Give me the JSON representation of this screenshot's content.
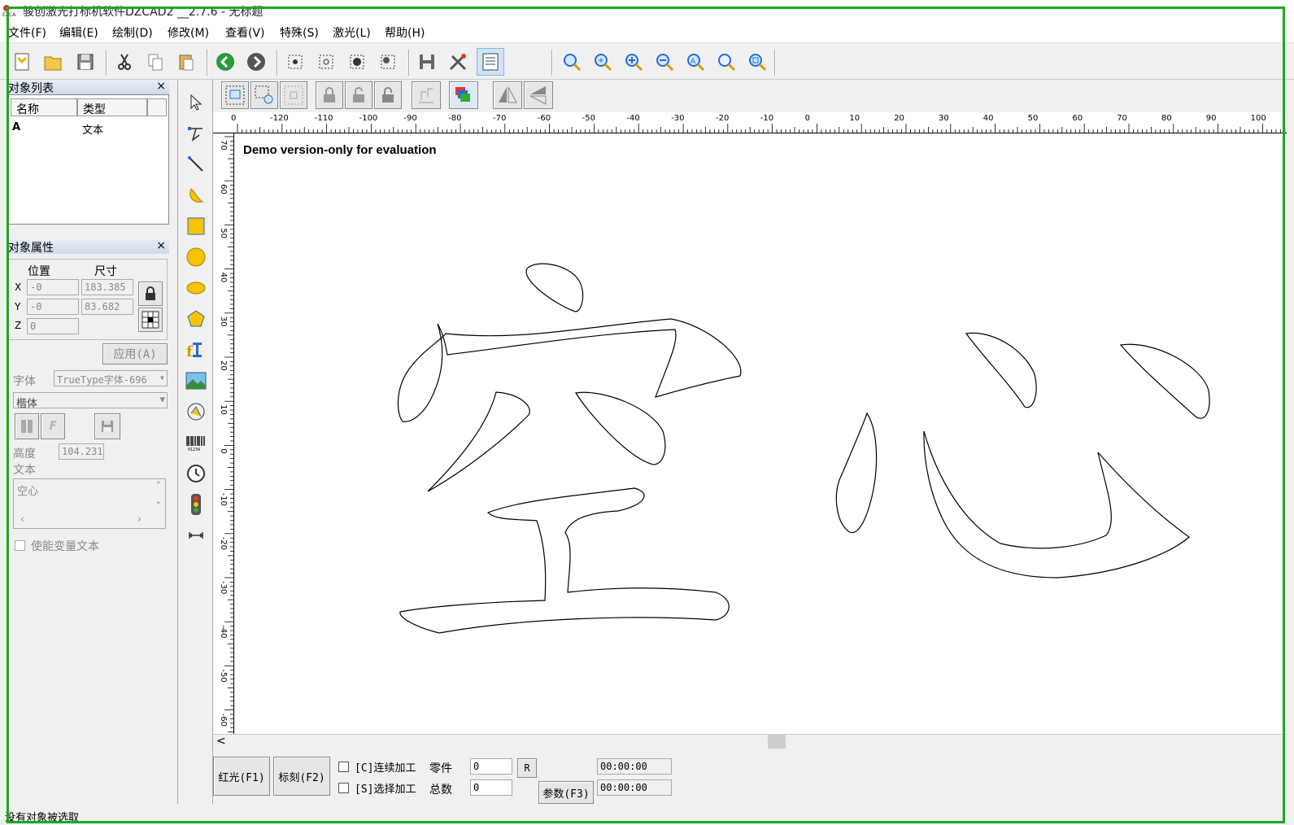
{
  "window": {
    "title": "骏创激光打标机软件DZCAD2 __2.7.6 - 无标题"
  },
  "menu": [
    {
      "label": "文件(F)"
    },
    {
      "label": "编辑(E)"
    },
    {
      "label": "绘制(D)"
    },
    {
      "label": "修改(M)"
    },
    {
      "label": "查看(V)"
    },
    {
      "label": "特殊(S)"
    },
    {
      "label": "激光(L)"
    },
    {
      "label": "帮助(H)"
    }
  ],
  "object_list": {
    "title": "对象列表",
    "close": "×",
    "col_name": "名称",
    "col_type": "类型",
    "rows": [
      {
        "name": "A",
        "type": "文本"
      }
    ]
  },
  "object_props": {
    "title": "对象属性",
    "close": "×",
    "position_label": "位置",
    "size_label": "尺寸",
    "x_label": "X",
    "y_label": "Y",
    "z_label": "Z",
    "x_pos": "-0",
    "y_pos": "-0",
    "z_pos": "0",
    "x_size": "183.385",
    "y_size": "83.682",
    "apply_label": "应用(A)",
    "font_label": "字体",
    "font_type": "TrueType字体-696",
    "font_name": "楷体",
    "height_label": "高度",
    "height_value": "104.231",
    "text_label": "文本",
    "text_value": "空心",
    "variable_text_label": "使能变量文本"
  },
  "canvas": {
    "watermark": "Demo version-only for evaluation",
    "ruler_top_labels": [
      "0",
      "-120",
      "-110",
      "-100",
      "-90",
      "-80",
      "-70",
      "-60",
      "-50",
      "-40",
      "-30",
      "-20",
      "-10",
      "0",
      "10",
      "20",
      "30",
      "40",
      "50",
      "60",
      "70",
      "80",
      "90",
      "100"
    ],
    "ruler_left_labels": [
      "70",
      "60",
      "50",
      "40",
      "30",
      "20",
      "10",
      "0",
      "-10",
      "-20",
      "-30",
      "-40",
      "-50",
      "-60"
    ]
  },
  "bottom": {
    "red_light": "红光(F1)",
    "mark": "标刻(F2)",
    "continuous": "[C]连续加工",
    "select_process": "[S]选择加工",
    "parts_label": "零件",
    "total_label": "总数",
    "parts_value": "0",
    "total_value": "0",
    "r_label": "R",
    "params": "参数(F3)",
    "time1": "00:00:00",
    "time2": "00:00:00"
  },
  "status": {
    "text": "没有对象被选取"
  },
  "colors": {
    "frame": "#1fa71f"
  }
}
